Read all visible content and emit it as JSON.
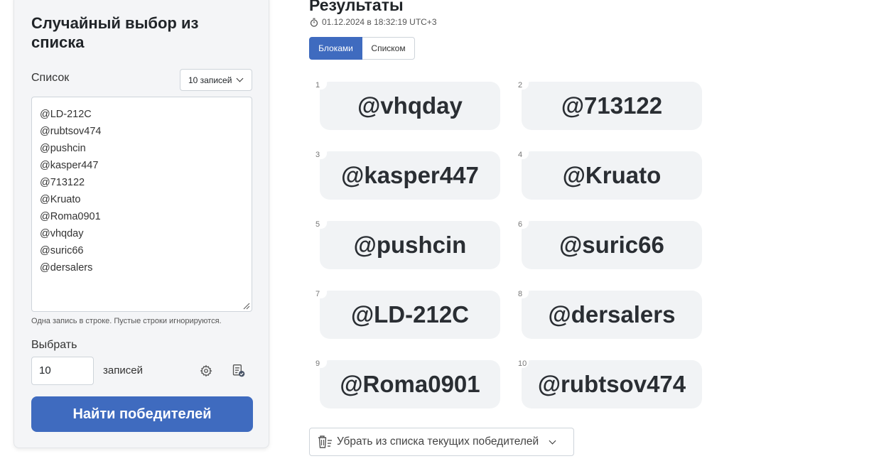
{
  "sidebar": {
    "title": "Случайный выбор из списка",
    "list_label": "Список",
    "count_select_value": "10 записей",
    "entries": [
      "@LD-212C",
      "@rubtsov474",
      "@pushcin",
      "@kasper447",
      "@713122",
      "@Kruato",
      "@Roma0901",
      "@vhqday",
      "@suric66",
      "@dersalers"
    ],
    "hint": "Одна запись в строке. Пустые строки игнорируются.",
    "pick_label": "Выбрать",
    "pick_count": "10",
    "records_word": "записей",
    "find_button": "Найти победителей"
  },
  "results": {
    "title": "Результаты",
    "timestamp": "01.12.2024 в 18:32:19 UTC+3",
    "view_blocks": "Блоками",
    "view_list": "Списком",
    "winners": [
      {
        "n": "1",
        "name": "@vhqday"
      },
      {
        "n": "2",
        "name": "@713122"
      },
      {
        "n": "3",
        "name": "@kasper447"
      },
      {
        "n": "4",
        "name": "@Kruato"
      },
      {
        "n": "5",
        "name": "@pushcin"
      },
      {
        "n": "6",
        "name": "@suric66"
      },
      {
        "n": "7",
        "name": "@LD-212C"
      },
      {
        "n": "8",
        "name": "@dersalers"
      },
      {
        "n": "9",
        "name": "@Roma0901"
      },
      {
        "n": "10",
        "name": "@rubtsov474"
      }
    ],
    "remove_button": "Убрать из списка текущих победителей"
  },
  "colors": {
    "accent": "#3f6bbf",
    "block_bg": "#f1f3f5",
    "card_bg": "#f4f5f7"
  }
}
